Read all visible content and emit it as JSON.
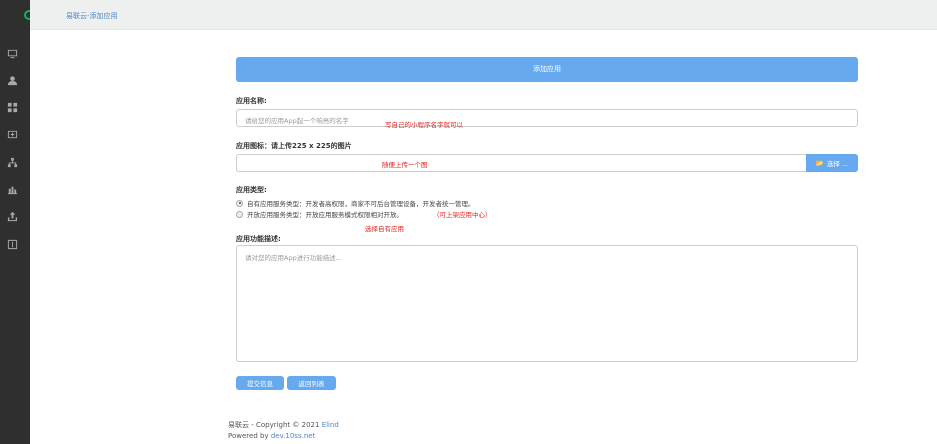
{
  "header": {
    "breadcrumb": "易联云-添加应用"
  },
  "form": {
    "title": "添加应用",
    "name_label": "应用名称:",
    "name_placeholder": "请给您的应用App起一个响亮的名字",
    "name_note": "写自己的小程序名字就可以",
    "icon_label": "应用图标：请上传225 x 225的图片",
    "icon_note": "随便上传一个图",
    "choose_label": "选择 ...",
    "type_label": "应用类型:",
    "type_options": [
      {
        "label": "自有应用服务类型：开发者高权限，商家不可后台管理设备，开发者统一管理。",
        "checked": true
      },
      {
        "label": "开放应用服务类型：开放应用服务模式权限相对开放。",
        "checked": false
      }
    ],
    "type_option2_note": "（可上架应用中心）",
    "type_note": "选择自有应用",
    "desc_label": "应用功能描述:",
    "desc_placeholder": "请对您的应用App进行功能描述...",
    "submit_label": "提交信息",
    "back_label": "返回列表"
  },
  "footer": {
    "copyright": "易联云 - Copyright © 2021",
    "company": "Elind",
    "powered": "Powered by",
    "powered_link": "dev.10ss.net"
  }
}
